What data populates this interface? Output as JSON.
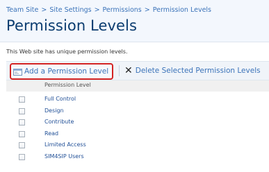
{
  "breadcrumb": [
    "Team Site",
    "Site Settings",
    "Permissions",
    "Permission Levels"
  ],
  "breadcrumb_separator": ">",
  "page_title": "Permission Levels",
  "description": "This Web site has unique permission levels.",
  "toolbar": {
    "add_label": "Add a Permission Level",
    "add_icon": "new-item-icon",
    "delete_label": "Delete Selected Permission Levels",
    "delete_icon": "delete-x-icon"
  },
  "table": {
    "column_header": "Permission Level",
    "rows": [
      {
        "label": "Full Control"
      },
      {
        "label": "Design"
      },
      {
        "label": "Contribute"
      },
      {
        "label": "Read"
      },
      {
        "label": "Limited Access"
      },
      {
        "label": "SIM4SIP Users"
      }
    ]
  },
  "colors": {
    "link": "#3b73b9",
    "title": "#0b3c6f",
    "highlight_border": "#d42323"
  }
}
